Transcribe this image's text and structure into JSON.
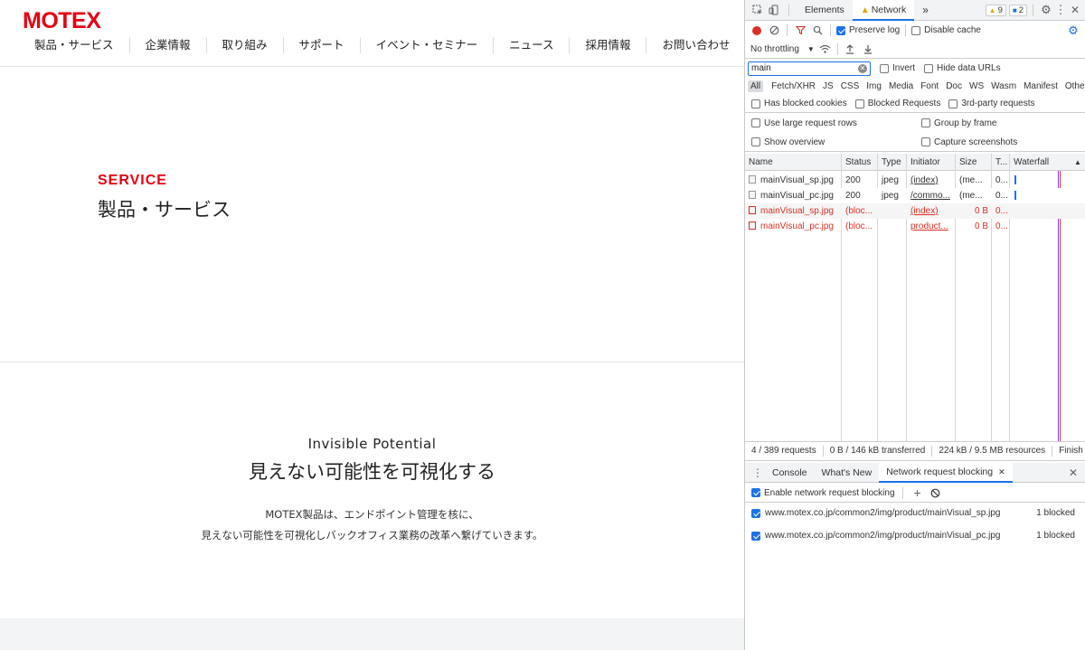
{
  "site": {
    "logo": "MOTEX",
    "nav": [
      "製品・サービス",
      "企業情報",
      "取り組み",
      "サポート",
      "イベント・セミナー",
      "ニュース",
      "採用情報",
      "お問い合わせ"
    ],
    "service_en": "SERVICE",
    "service_ja": "製品・サービス",
    "section_en": "Invisible Potential",
    "section_ja": "見えない可能性を可視化する",
    "desc_line1": "MOTEX製品は、エンドポイント管理を核に、",
    "desc_line2": "見えない可能性を可視化しバックオフィス業務の改革へ繋げていきます。",
    "colors": {
      "brand": "#e60012",
      "footer_band": "#f2f4f5"
    }
  },
  "devtools": {
    "tabs": {
      "elements": "Elements",
      "network": "Network",
      "more": "»"
    },
    "warnings": "9",
    "messages": "2",
    "toolbar": {
      "preserve_log": "Preserve log",
      "disable_cache": "Disable cache",
      "throttling": "No throttling"
    },
    "filter": {
      "value": "main",
      "invert": "Invert",
      "hide_data_urls": "Hide data URLs"
    },
    "types": [
      "All",
      "Fetch/XHR",
      "JS",
      "CSS",
      "Img",
      "Media",
      "Font",
      "Doc",
      "WS",
      "Wasm",
      "Manifest",
      "Other"
    ],
    "options": {
      "has_blocked_cookies": "Has blocked cookies",
      "blocked_requests": "Blocked Requests",
      "third_party": "3rd-party requests",
      "large_rows": "Use large request rows",
      "group_by_frame": "Group by frame",
      "show_overview": "Show overview",
      "capture_screenshots": "Capture screenshots"
    },
    "table": {
      "headers": {
        "name": "Name",
        "status": "Status",
        "type": "Type",
        "initiator": "Initiator",
        "size": "Size",
        "time": "T...",
        "waterfall": "Waterfall"
      },
      "rows": [
        {
          "name": "mainVisual_sp.jpg",
          "status": "200",
          "type": "jpeg",
          "initiator": "(index)",
          "size": "(me...",
          "time": "0..."
        },
        {
          "name": "mainVisual_pc.jpg",
          "status": "200",
          "type": "jpeg",
          "initiator": "/commo...",
          "size": "(me...",
          "time": "0..."
        },
        {
          "name": "mainVisual_sp.jpg",
          "status": "(bloc...",
          "type": "",
          "initiator": "(index)",
          "size": "0 B",
          "time": "0..."
        },
        {
          "name": "mainVisual_pc.jpg",
          "status": "(bloc...",
          "type": "",
          "initiator": "product...",
          "size": "0 B",
          "time": "0..."
        }
      ]
    },
    "status_bar": {
      "requests": "4 / 389 requests",
      "transferred": "0 B / 146 kB transferred",
      "resources": "224 kB / 9.5 MB resources",
      "finish": "Finish"
    },
    "drawer": {
      "tabs": {
        "console": "Console",
        "whats_new": "What's New",
        "blocking": "Network request blocking"
      },
      "enable_label": "Enable network request blocking",
      "patterns": [
        {
          "url": "www.motex.co.jp/common2/img/product/mainVisual_sp.jpg",
          "count": "1 blocked"
        },
        {
          "url": "www.motex.co.jp/common2/img/product/mainVisual_pc.jpg",
          "count": "1 blocked"
        }
      ]
    },
    "colors": {
      "accent": "#1a73e8",
      "error": "#d93025",
      "record": "#d93025"
    }
  }
}
